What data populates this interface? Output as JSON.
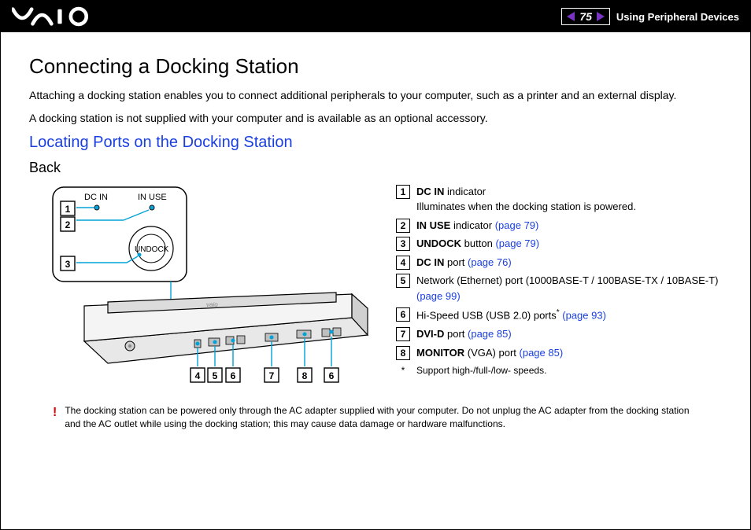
{
  "header": {
    "page_number": "75",
    "section": "Using Peripheral Devices"
  },
  "content": {
    "h1": "Connecting a Docking Station",
    "p1": "Attaching a docking station enables you to connect additional peripherals to your computer, such as a printer and an external display.",
    "p2": "A docking station is not supplied with your computer and is available as an optional accessory.",
    "h2": "Locating Ports on the Docking Station",
    "h3": "Back"
  },
  "diagram_labels": {
    "dc_in": "DC IN",
    "in_use": "IN USE",
    "undock": "UNDOCK",
    "top_nums": [
      "1",
      "2",
      "3"
    ],
    "bottom_nums": [
      "4",
      "5",
      "6",
      "7",
      "8",
      "6"
    ]
  },
  "legend": [
    {
      "n": "1",
      "bold": "DC IN",
      "rest": " indicator",
      "line2": "Illuminates when the docking station is powered."
    },
    {
      "n": "2",
      "bold": "IN USE",
      "rest": " indicator ",
      "ref": "(page 79)"
    },
    {
      "n": "3",
      "bold": "UNDOCK",
      "rest": " button ",
      "ref": "(page 79)"
    },
    {
      "n": "4",
      "bold": "DC IN",
      "rest": " port ",
      "ref": "(page 76)"
    },
    {
      "n": "5",
      "plain": "Network (Ethernet) port (1000BASE-T / 100BASE-TX / 10BASE-T) ",
      "ref": "(page 99)"
    },
    {
      "n": "6",
      "plain": "Hi-Speed USB (USB 2.0) ports",
      "star": "*",
      "sp": " ",
      "ref": "(page 93)"
    },
    {
      "n": "7",
      "bold": "DVI-D",
      "rest": " port ",
      "ref": "(page 85)"
    },
    {
      "n": "8",
      "bold": "MONITOR",
      "rest": " (VGA) port ",
      "ref": "(page 85)"
    }
  ],
  "footnote": {
    "mark": "*",
    "text": "Support high-/full-/low- speeds."
  },
  "warning": {
    "mark": "!",
    "text": "The docking station can be powered only through the AC adapter supplied with your computer. Do not unplug the AC adapter from the docking station and the AC outlet while using the docking station; this may cause data damage or hardware malfunctions."
  }
}
